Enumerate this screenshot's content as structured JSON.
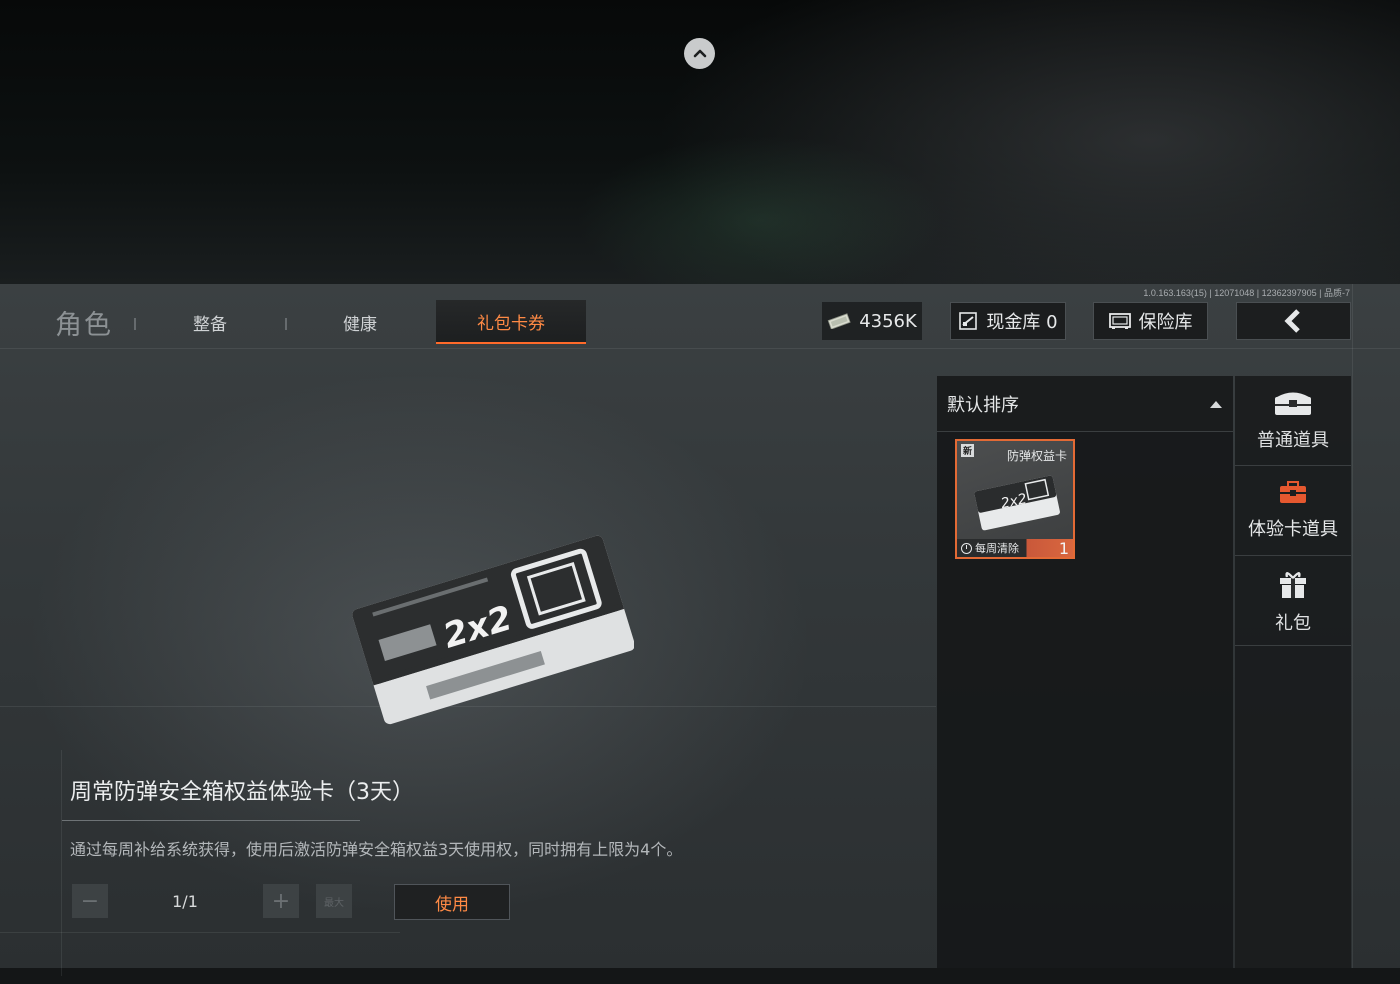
{
  "top": {
    "collapse_icon": "chevron-up-icon"
  },
  "version": "1.0.163.163(15) | 12071048 | 12362397905 | 品质-7",
  "tabs": {
    "title": "角色",
    "items": [
      {
        "label": "整备"
      },
      {
        "label": "健康"
      },
      {
        "label": "礼包卡券",
        "active": true
      }
    ]
  },
  "resources": {
    "money": {
      "icon": "banknote-icon",
      "value": "4356K"
    },
    "cash_vault": {
      "icon": "cash-vault-icon",
      "label": "现金库 0"
    },
    "safe": {
      "icon": "safe-icon",
      "label": "保险库"
    },
    "back_icon": "chevron-left-icon"
  },
  "list": {
    "sort_label": "默认排序",
    "sort_icon": "caret-up-icon",
    "items": [
      {
        "badge": "新",
        "name": "防弹权益卡",
        "footer_label": "每周清除",
        "quantity": "1",
        "selected": true
      }
    ]
  },
  "categories": [
    {
      "icon": "chest-icon",
      "label": "普通道具"
    },
    {
      "icon": "card-case-icon",
      "label": "体验卡道具",
      "active": true
    },
    {
      "icon": "gift-icon",
      "label": "礼包"
    }
  ],
  "detail": {
    "title": "周常防弹安全箱权益体验卡（3天）",
    "description": "通过每周补给系统获得，使用后激活防弹安全箱权益3天使用权，同时拥有上限为4个。",
    "art_text": "2x2"
  },
  "actions": {
    "minus_label": "−",
    "quantity": "1/1",
    "plus_label": "+",
    "max_label": "最大",
    "use_label": "使用"
  },
  "colors": {
    "accent": "#ff6a2a",
    "accent_text": "#ff8a45",
    "panel": "#33383a"
  }
}
